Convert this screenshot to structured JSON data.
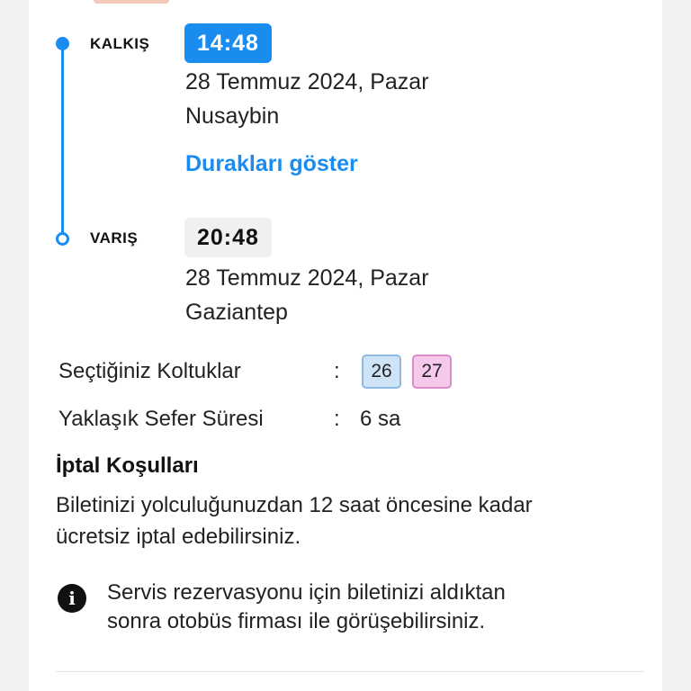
{
  "journey": {
    "departure": {
      "label": "KALKIŞ",
      "time": "14:48",
      "date": "28 Temmuz 2024, Pazar",
      "city": "Nusaybin"
    },
    "stops_link": "Durakları göster",
    "arrival": {
      "label": "VARIŞ",
      "time": "20:48",
      "date": "28 Temmuz 2024, Pazar",
      "city": "Gaziantep"
    }
  },
  "details": {
    "seats_label": "Seçtiğiniz Koltuklar",
    "colon": ":",
    "seats": [
      "26",
      "27"
    ],
    "duration_label": "Yaklaşık Sefer Süresi",
    "duration_value": "6 sa"
  },
  "cancellation": {
    "title": "İptal Koşulları",
    "line1": "Biletinizi yolculuğunuzdan 12 saat öncesine kadar",
    "line2": "ücretsiz iptal edebilirsiniz."
  },
  "notice": {
    "icon": "info-icon",
    "line1": "Servis rezervasyonu için biletinizi aldıktan",
    "line2": "sonra otobüs firması ile görüşebilirsiniz."
  },
  "colors": {
    "accent": "#1a8cf0",
    "seat_male": "#cfe3f6",
    "seat_female": "#f6c8ea"
  }
}
